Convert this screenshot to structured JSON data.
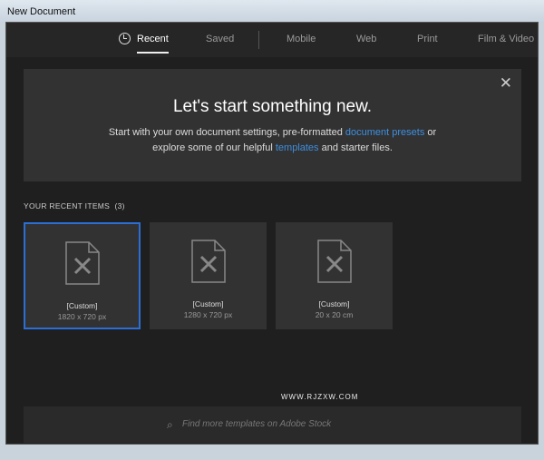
{
  "window": {
    "title": "New Document"
  },
  "tabs": [
    {
      "label": "Recent"
    },
    {
      "label": "Saved"
    },
    {
      "label": "Mobile"
    },
    {
      "label": "Web"
    },
    {
      "label": "Print"
    },
    {
      "label": "Film & Video"
    }
  ],
  "hero": {
    "title": "Let's start something new.",
    "line1_pre": "Start with your own document settings, pre-formatted ",
    "link1": "document presets",
    "line1_post": " or",
    "line2_pre": "explore some of our helpful ",
    "link2": "templates",
    "line2_post": " and starter files.",
    "close": "✕"
  },
  "recent": {
    "heading": "YOUR RECENT ITEMS",
    "count": "(3)",
    "items": [
      {
        "name": "[Custom]",
        "size": "1820 x 720 px"
      },
      {
        "name": "[Custom]",
        "size": "1280 x 720 px"
      },
      {
        "name": "[Custom]",
        "size": "20 x 20 cm"
      }
    ]
  },
  "search": {
    "placeholder": "Find more templates on Adobe Stock"
  },
  "watermark": "WWW.RJZXW.COM"
}
